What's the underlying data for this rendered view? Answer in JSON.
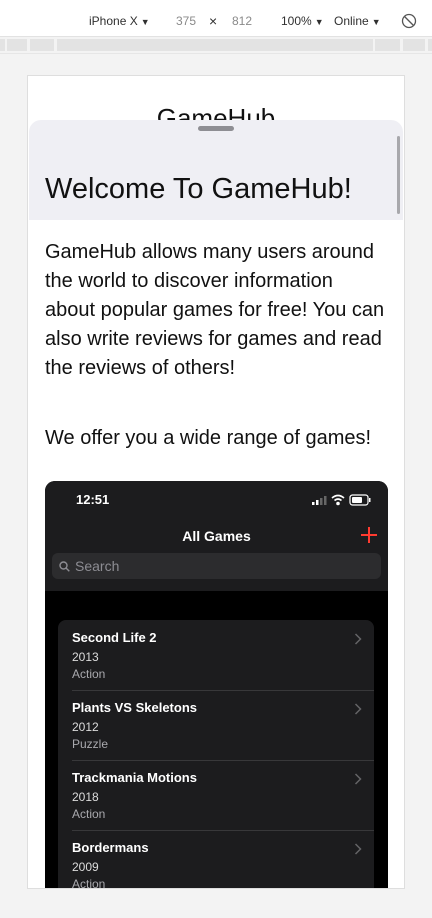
{
  "devtools": {
    "device": "iPhone X",
    "width": "375",
    "times": "×",
    "height": "812",
    "zoom": "100%",
    "throttle": "Online",
    "caret": "▼"
  },
  "page": {
    "background_title": "GameHub",
    "sheet_title": "Welcome To GameHub!",
    "description": "GameHub allows many users around the world to discover information about popular games for free! You can also write reviews for games and read the reviews of others!",
    "offer": "We offer you a wide range of games!"
  },
  "phone": {
    "time": "12:51",
    "nav_title": "All Games",
    "search_placeholder": "Search",
    "accent": "#ff3b30",
    "games": [
      {
        "name": "Second Life 2",
        "year": "2013",
        "genre": "Action"
      },
      {
        "name": "Plants VS Skeletons",
        "year": "2012",
        "genre": "Puzzle"
      },
      {
        "name": "Trackmania Motions",
        "year": "2018",
        "genre": "Action"
      },
      {
        "name": "Bordermans",
        "year": "2009",
        "genre": "Action"
      }
    ]
  }
}
